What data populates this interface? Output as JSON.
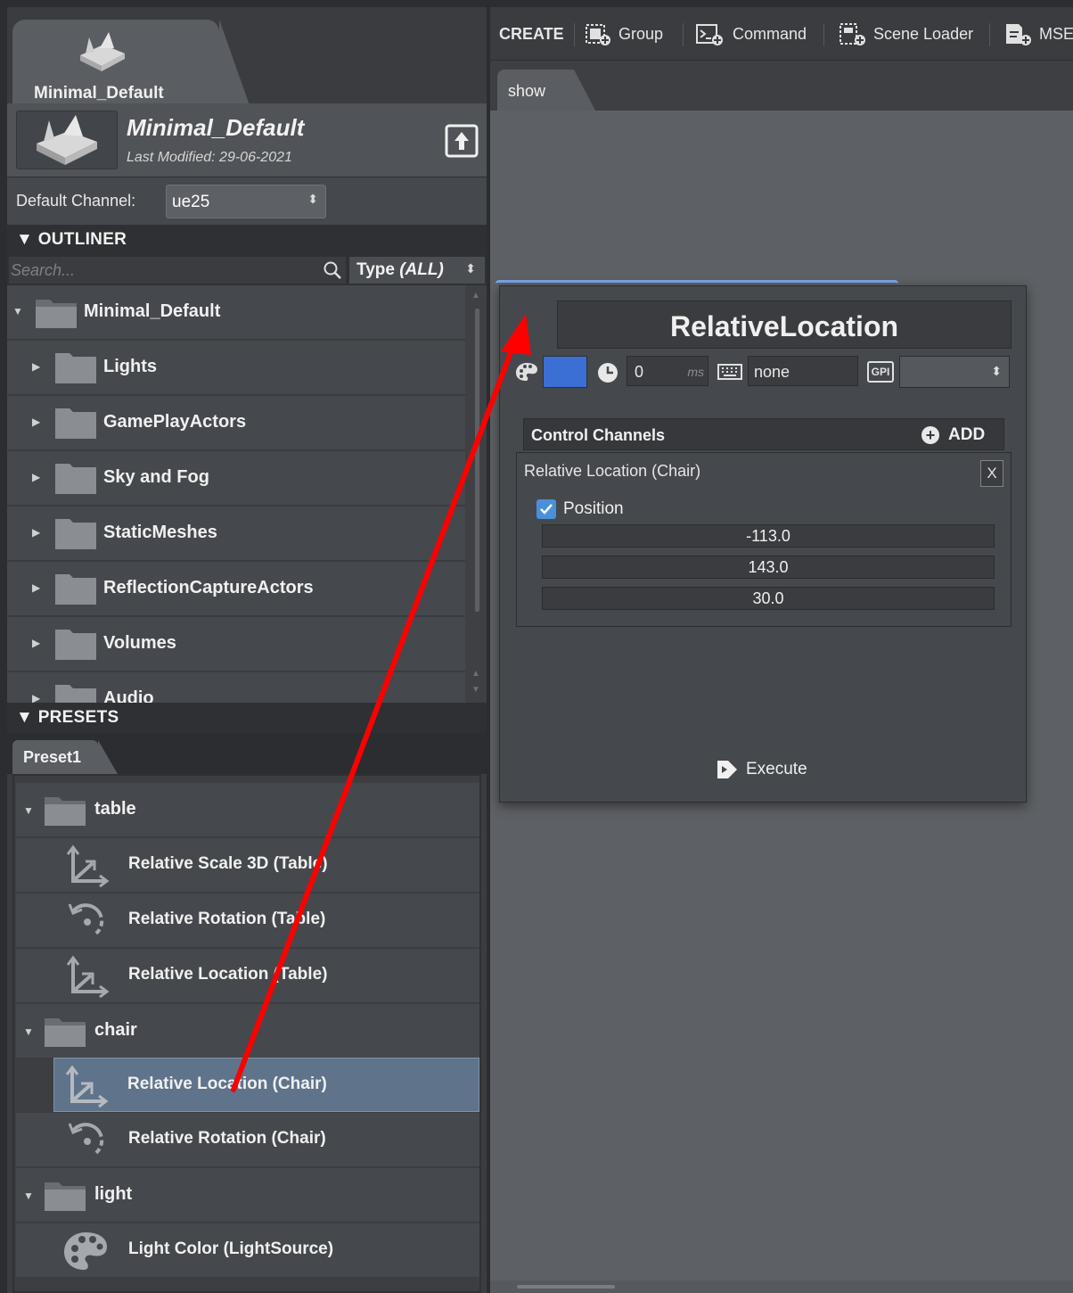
{
  "project_tab": {
    "label": "Minimal_Default"
  },
  "project": {
    "title": "Minimal_Default",
    "last_modified": "Last Modified: 29-06-2021"
  },
  "channel": {
    "label": "Default Channel:",
    "value": "ue25"
  },
  "outliner": {
    "header": "OUTLINER",
    "search_placeholder": "Search...",
    "type_filter": {
      "label": "Type",
      "value": "(ALL)"
    },
    "items": [
      {
        "label": "Minimal_Default"
      },
      {
        "label": "Lights"
      },
      {
        "label": "GamePlayActors"
      },
      {
        "label": "Sky and Fog"
      },
      {
        "label": "StaticMeshes"
      },
      {
        "label": "ReflectionCaptureActors"
      },
      {
        "label": "Volumes"
      },
      {
        "label": "Audio"
      }
    ]
  },
  "presets": {
    "header": "PRESETS",
    "tab": "Preset1",
    "rows": [
      {
        "kind": "folder",
        "label": "table"
      },
      {
        "kind": "item",
        "icon": "scale-axes-icon",
        "label": "Relative Scale 3D (Table)"
      },
      {
        "kind": "item",
        "icon": "rotation-icon",
        "label": "Relative Rotation (Table)"
      },
      {
        "kind": "item",
        "icon": "location-axes-icon",
        "label": "Relative Location (Table)"
      },
      {
        "kind": "folder",
        "label": "chair"
      },
      {
        "kind": "item",
        "icon": "location-axes-icon",
        "label": "Relative Location (Chair)",
        "selected": true
      },
      {
        "kind": "item",
        "icon": "rotation-icon",
        "label": "Relative Rotation (Chair)"
      },
      {
        "kind": "folder",
        "label": "light"
      },
      {
        "kind": "item",
        "icon": "palette-icon",
        "label": "Light Color (LightSource)"
      }
    ]
  },
  "toolbar": {
    "create": "CREATE",
    "group": "Group",
    "command": "Command",
    "scene_loader": "Scene Loader",
    "mse": "MSE"
  },
  "show_tab": {
    "label": "show"
  },
  "command_card": {
    "title": "RelativeLocation",
    "color": "#3b6fd4",
    "delay_value": "0",
    "delay_unit": "ms",
    "shortcut": "none",
    "gpi_label": "GPI",
    "gpi_value": "",
    "control_channels": {
      "label": "Control Channels",
      "add_label": "ADD"
    },
    "channel_entry": {
      "name": "Relative Location (Chair)",
      "remove_label": "X",
      "position_label": "Position",
      "position_checked": true,
      "values": [
        "-113.0",
        "143.0",
        "30.0"
      ]
    },
    "execute_label": "Execute"
  },
  "colors": {
    "accent": "#3b6fd4",
    "selection": "#5f738b",
    "arrow": "#ff0000"
  }
}
